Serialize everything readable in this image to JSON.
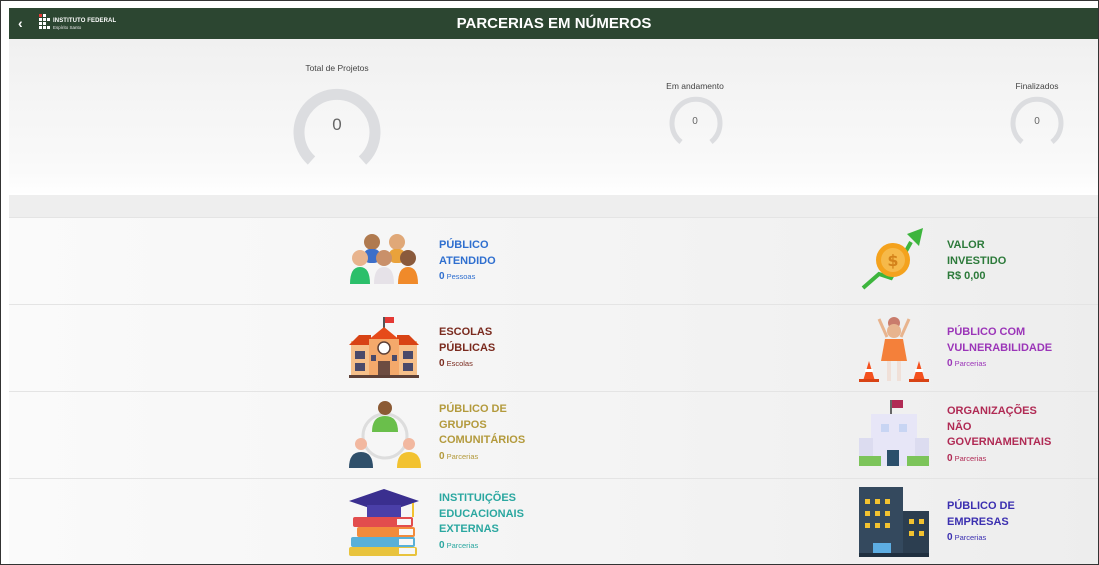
{
  "header": {
    "title": "PARCERIAS EM NÚMEROS",
    "back_icon": "‹",
    "logo_text": "INSTITUTO FEDERAL",
    "logo_sub": "Espírito Santo"
  },
  "stats": [
    {
      "label": "Total de Projetos",
      "value": "0"
    },
    {
      "label": "Em andamento",
      "value": "0"
    },
    {
      "label": "Finalizados",
      "value": "0"
    }
  ],
  "items": {
    "publico_atendido": {
      "label": "PÚBLICO\nATENDIDO",
      "value": "0",
      "unit": "Pessoas",
      "color": "#2f6fcf"
    },
    "valor_investido": {
      "label": "VALOR\nINVESTIDO",
      "value": "R$ 0,00",
      "unit": "",
      "color": "#2c7a3a"
    },
    "escolas_publicas": {
      "label": "ESCOLAS\nPÚBLICAS",
      "value": "0",
      "unit": "Escolas",
      "color": "#7a2a1e"
    },
    "publico_vulnerabilidade": {
      "label": "PÚBLICO COM\nVULNERABILIDADE",
      "value": "0",
      "unit": "Parcerias",
      "color": "#9b35b8"
    },
    "grupos_comunitarios": {
      "label": "PÚBLICO DE\nGRUPOS\nCOMUNITÁRIOS",
      "value": "0",
      "unit": "Parcerias",
      "color": "#b39a3c"
    },
    "ongs": {
      "label": "ORGANIZAÇÕES\nNÃO\nGOVERNAMENTAIS",
      "value": "0",
      "unit": "Parcerias",
      "color": "#b02a54"
    },
    "instituicoes": {
      "label": "INSTITUIÇÕES\nEDUCACIONAIS\nEXTERNAS",
      "value": "0",
      "unit": "Parcerias",
      "color": "#2aa7a0"
    },
    "empresas": {
      "label": "PÚBLICO DE\nEMPRESAS",
      "value": "0",
      "unit": "Parcerias",
      "color": "#3b2fb0"
    }
  }
}
